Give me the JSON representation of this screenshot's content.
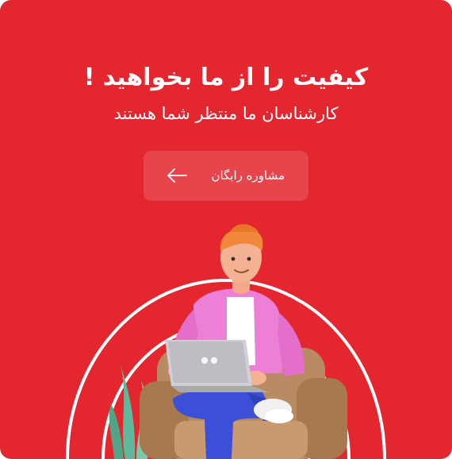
{
  "banner": {
    "headline": "کیفیت را از ما بخواهید !",
    "subheadline": "کارشناسان ما منتظر شما هستند",
    "cta_label": "مشاوره رایگان",
    "cta_icon": "arrow-left-icon"
  },
  "colors": {
    "background": "#E4262F",
    "text": "#FFFFFF",
    "button_fill": "rgba(255,255,255,0.14)",
    "shirt": "#EE7FD6",
    "jeans": "#3B4FD8",
    "hair": "#F0873A",
    "sofa": "#B98B62",
    "plant": "#5FB89A"
  }
}
